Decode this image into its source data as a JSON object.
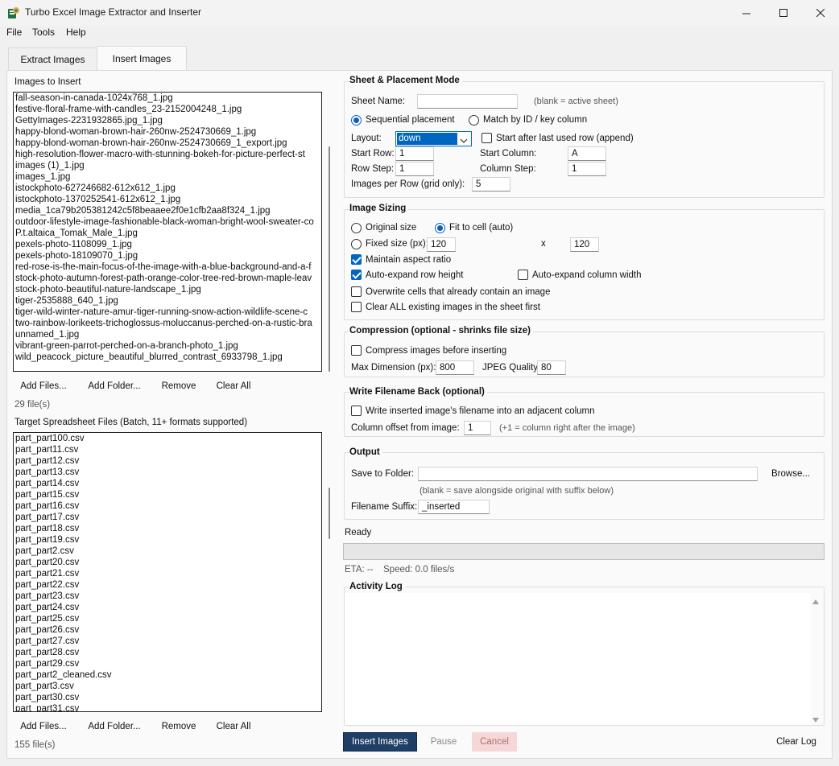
{
  "window": {
    "title": "Turbo Excel Image Extractor and Inserter"
  },
  "menu": [
    "File",
    "Tools",
    "Help"
  ],
  "tabs": [
    {
      "label": "Extract Images"
    },
    {
      "label": "Insert Images"
    }
  ],
  "images_panel": {
    "label": "Images to Insert",
    "files": [
      "fall-season-in-canada-1024x768_1.jpg",
      "festive-floral-frame-with-candles_23-2152004248_1.jpg",
      "GettyImages-2231932865.jpg_1.jpg",
      "happy-blond-woman-brown-hair-260nw-2524730669_1.jpg",
      "happy-blond-woman-brown-hair-260nw-2524730669_1_export.jpg",
      "high-resolution-flower-macro-with-stunning-bokeh-for-picture-perfect-st",
      "images (1)_1.jpg",
      "images_1.jpg",
      "istockphoto-627246682-612x612_1.jpg",
      "istockphoto-1370252541-612x612_1.jpg",
      "media_1ca79b205381242c5f8beaaee2f0e1cfb2aa8f324_1.jpg",
      "outdoor-lifestyle-image-fashionable-black-woman-bright-wool-sweater-co",
      "P.t.altaica_Tomak_Male_1.jpg",
      "pexels-photo-1108099_1.jpg",
      "pexels-photo-18109070_1.jpg",
      "red-rose-is-the-main-focus-of-the-image-with-a-blue-background-and-a-f",
      "stock-photo-autumn-forest-path-orange-color-tree-red-brown-maple-leav",
      "stock-photo-beautiful-nature-landscape_1.jpg",
      "tiger-2535888_640_1.jpg",
      "tiger-wild-winter-nature-amur-tiger-running-snow-action-wildlife-scene-c",
      "two-rainbow-lorikeets-trichoglossus-moluccanus-perched-on-a-rustic-bra",
      "unnamed_1.jpg",
      "vibrant-green-parrot-perched-on-a-branch-photo_1.jpg",
      "wild_peacock_picture_beautiful_blurred_contrast_6933798_1.jpg"
    ],
    "buttons": {
      "add_files": "Add Files...",
      "add_folder": "Add Folder...",
      "remove": "Remove",
      "clear_all": "Clear All"
    },
    "count": "29 file(s)"
  },
  "target_panel": {
    "label": "Target Spreadsheet Files (Batch, 11+ formats supported)",
    "files": [
      "part_part100.csv",
      "part_part11.csv",
      "part_part12.csv",
      "part_part13.csv",
      "part_part14.csv",
      "part_part15.csv",
      "part_part16.csv",
      "part_part17.csv",
      "part_part18.csv",
      "part_part19.csv",
      "part_part2.csv",
      "part_part20.csv",
      "part_part21.csv",
      "part_part22.csv",
      "part_part23.csv",
      "part_part24.csv",
      "part_part25.csv",
      "part_part26.csv",
      "part_part27.csv",
      "part_part28.csv",
      "part_part29.csv",
      "part_part2_cleaned.csv",
      "part_part3.csv",
      "part_part30.csv",
      "part_part31.csv"
    ],
    "buttons": {
      "add_files": "Add Files...",
      "add_folder": "Add Folder...",
      "remove": "Remove",
      "clear_all": "Clear All"
    },
    "count": "155 file(s)"
  },
  "sheet_mode": {
    "title": "Sheet & Placement Mode",
    "sheet_name_label": "Sheet Name:",
    "sheet_name_value": "",
    "sheet_name_hint": "(blank = active sheet)",
    "sequential_label": "Sequential placement",
    "match_label": "Match by ID / key column",
    "layout_label": "Layout:",
    "layout_value": "down",
    "append_label": "Start after last used row (append)",
    "start_row_label": "Start Row:",
    "start_row_value": "1",
    "start_col_label": "Start Column:",
    "start_col_value": "A",
    "row_step_label": "Row Step:",
    "row_step_value": "1",
    "col_step_label": "Column Step:",
    "col_step_value": "1",
    "per_row_label": "Images per Row (grid only):",
    "per_row_value": "5"
  },
  "sizing": {
    "title": "Image Sizing",
    "original_label": "Original size",
    "fit_label": "Fit to cell (auto)",
    "fixed_label": "Fixed size (px):",
    "width_value": "120",
    "x_label": "x",
    "height_value": "120",
    "aspect_label": "Maintain aspect ratio",
    "row_height_label": "Auto-expand row height",
    "col_width_label": "Auto-expand column width",
    "overwrite_label": "Overwrite cells that already contain an image",
    "clear_all_label": "Clear ALL existing images in the sheet first"
  },
  "compression": {
    "title": "Compression (optional - shrinks file size)",
    "compress_label": "Compress images before inserting",
    "max_dim_label": "Max Dimension (px):",
    "max_dim_value": "800",
    "quality_label": "JPEG Quality:",
    "quality_value": "80"
  },
  "filename_back": {
    "title": "Write Filename Back (optional)",
    "write_label": "Write inserted image's filename into an adjacent column",
    "offset_label": "Column offset from image:",
    "offset_value": "1",
    "offset_hint": "(+1 = column right after the image)"
  },
  "output": {
    "title": "Output",
    "folder_label": "Save to Folder:",
    "folder_value": "",
    "browse": "Browse...",
    "folder_hint": "(blank = save alongside original with suffix below)",
    "suffix_label": "Filename Suffix:",
    "suffix_value": "_inserted"
  },
  "status": {
    "text": "Ready",
    "progress": 0,
    "eta": "ETA: --",
    "speed": "Speed: 0.0 files/s"
  },
  "log": {
    "title": "Activity Log",
    "content": ""
  },
  "actions": {
    "insert": "Insert Images",
    "pause": "Pause",
    "cancel": "Cancel",
    "clear_log": "Clear Log"
  },
  "colors": {
    "accent": "#0067c0",
    "insert_button": "#1f3f66",
    "cancel_button": "#f6d7d7"
  }
}
